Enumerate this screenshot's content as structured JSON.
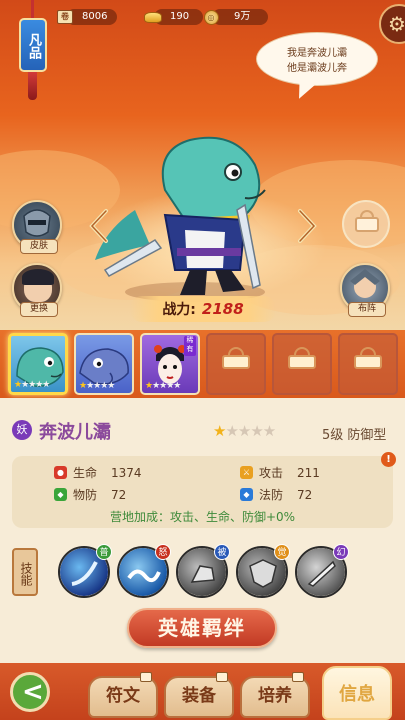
{
  "resources": {
    "ticket": "8006",
    "gold": "190",
    "coins": "9万"
  },
  "quality_tag": "凡品",
  "speech": [
    "我是奔波儿灞",
    "他是灞波儿奔"
  ],
  "side_buttons": {
    "skin": "皮肤",
    "change": "更换",
    "formation": "布阵"
  },
  "power": {
    "label": "战力:",
    "value": "2188"
  },
  "hero_slots": [
    {
      "type": "hero",
      "stars": 1,
      "selected": true
    },
    {
      "type": "hero",
      "stars": 1,
      "selected": false
    },
    {
      "type": "hero",
      "stars": 1,
      "selected": false,
      "badge": "稀有"
    },
    {
      "type": "locked"
    },
    {
      "type": "locked"
    },
    {
      "type": "locked"
    }
  ],
  "hero": {
    "class_icon": "妖",
    "name": "奔波儿灞",
    "stars": 1,
    "max_stars": 5,
    "level_type": "5级 防御型"
  },
  "stats": {
    "hp_label": "生命",
    "hp": "1374",
    "atk_label": "攻击",
    "atk": "211",
    "pdef_label": "物防",
    "pdef": "72",
    "mdef_label": "法防",
    "mdef": "72",
    "camp_bonus": "营地加成：攻击、生命、防御+0%"
  },
  "skills_label": "技能",
  "skills": [
    {
      "badge": "普",
      "color": "#3a9a3a"
    },
    {
      "badge": "怒",
      "color": "#c8301e"
    },
    {
      "badge": "被",
      "color": "#2a5ab8"
    },
    {
      "badge": "觉",
      "color": "#e0901a"
    },
    {
      "badge": "幻",
      "color": "#7a3ab8"
    }
  ],
  "bond_button": "英雄羁绊",
  "nav": {
    "tab1": "符文",
    "tab2": "装备",
    "tab3": "培养",
    "tab4": "信息"
  }
}
